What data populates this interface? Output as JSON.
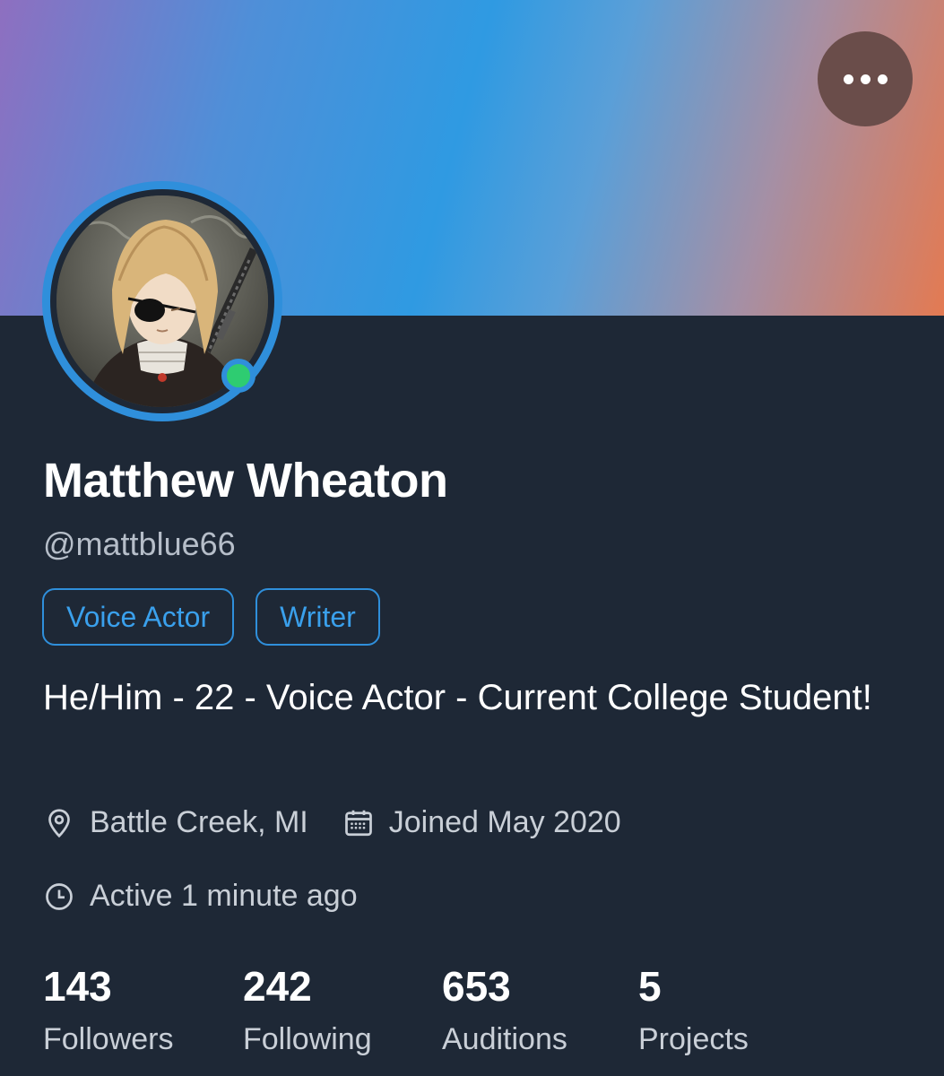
{
  "profile": {
    "name": "Matthew Wheaton",
    "handle": "@mattblue66",
    "tags": [
      "Voice Actor",
      "Writer"
    ],
    "bio": "He/Him - 22 - Voice Actor - Current College Student!",
    "location": "Battle Creek, MI",
    "joined": "Joined May 2020",
    "active": "Active 1 minute ago",
    "status_color": "#2ecc71"
  },
  "stats": [
    {
      "value": "143",
      "label": "Followers"
    },
    {
      "value": "242",
      "label": "Following"
    },
    {
      "value": "653",
      "label": "Auditions"
    },
    {
      "value": "5",
      "label": "Projects"
    }
  ],
  "icons": {
    "more": "more-horizontal-icon",
    "location": "map-pin-icon",
    "calendar": "calendar-icon",
    "clock": "clock-icon"
  },
  "colors": {
    "background": "#1e2836",
    "accent": "#2f8fdb",
    "banner_start": "#8e6fc0",
    "banner_mid": "#2f9ae2",
    "banner_end": "#e37a52"
  }
}
